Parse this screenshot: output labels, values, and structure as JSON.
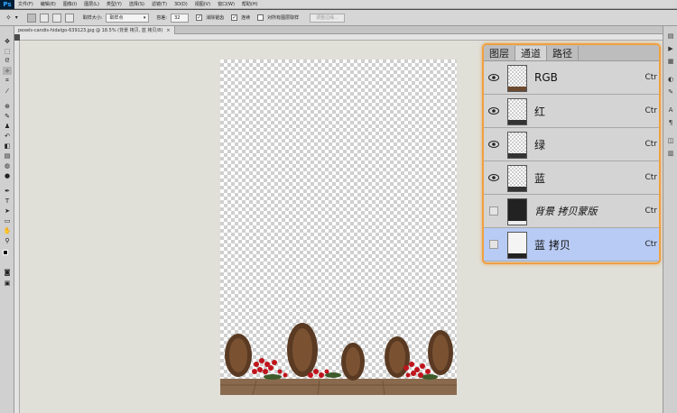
{
  "app": {
    "logo": "Ps"
  },
  "menu": [
    "文件(F)",
    "编辑(E)",
    "图像(I)",
    "图层(L)",
    "类型(Y)",
    "选择(S)",
    "滤镜(T)",
    "3D(D)",
    "视图(V)",
    "窗口(W)",
    "帮助(H)"
  ],
  "options": {
    "sample_size_label": "取样大小:",
    "sample_size_value": "取样点",
    "tolerance_label": "容差:",
    "tolerance_value": "32",
    "antialias_label": "消除锯齿",
    "contiguous_label": "连续",
    "sample_all_label": "对所有图层取样",
    "refine_edge_label": "调整边缘..."
  },
  "document": {
    "tab_title": "pexels-candis-hidalgo-639123.jpg @ 18.5% (背景 拷贝, 蓝 拷贝/8)",
    "close": "×"
  },
  "channels_panel": {
    "tabs": [
      "图层",
      "通道",
      "路径"
    ],
    "active_tab": 1,
    "rows": [
      {
        "name": "RGB",
        "shortcut": "Ctr",
        "visible": true,
        "thumb": "checker"
      },
      {
        "name": "红",
        "shortcut": "Ctr",
        "visible": true,
        "thumb": "checker"
      },
      {
        "name": "绿",
        "shortcut": "Ctr",
        "visible": true,
        "thumb": "checker"
      },
      {
        "name": "蓝",
        "shortcut": "Ctr",
        "visible": true,
        "thumb": "checker"
      },
      {
        "name": "背景 拷贝蒙版",
        "shortcut": "Ctr",
        "visible": false,
        "thumb": "dark"
      },
      {
        "name": "蓝 拷贝",
        "shortcut": "Ctr",
        "visible": false,
        "thumb": "light",
        "selected": true
      }
    ]
  },
  "colors": {
    "accent": "#f0a040",
    "selection": "#b8cbf4"
  }
}
